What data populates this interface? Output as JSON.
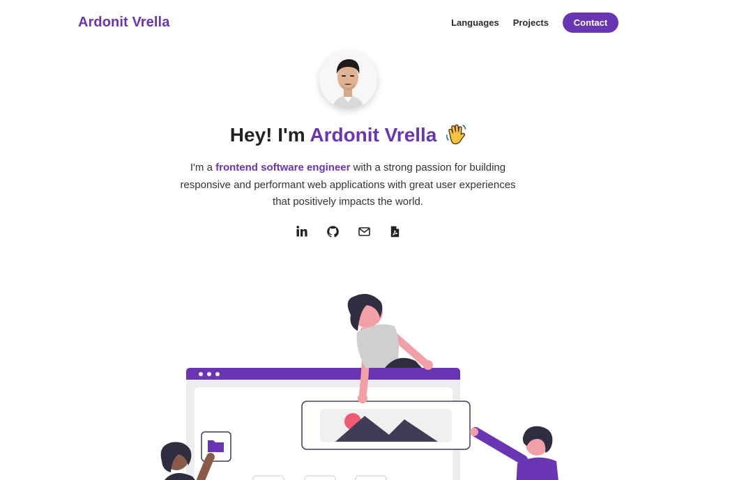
{
  "header": {
    "brand": "Ardonit Vrella",
    "nav": [
      {
        "label": "Languages"
      },
      {
        "label": "Projects"
      }
    ],
    "contact_label": "Contact"
  },
  "hero": {
    "greeting": "Hey! I'm",
    "name": "Ardonit Vrella",
    "wave_icon": "waving-hand-icon",
    "intro_prefix": "I'm a",
    "intro_highlight": "frontend software engineer",
    "intro_suffix": "with a strong passion for building responsive and performant web applications with great user experiences that positively impacts the world."
  },
  "social": [
    {
      "name": "linkedin-icon"
    },
    {
      "name": "github-icon"
    },
    {
      "name": "mail-icon"
    },
    {
      "name": "pdf-resume-icon"
    }
  ],
  "colors": {
    "accent": "#6a35b3",
    "text": "#222222",
    "illustration_pink": "#f2a0a7",
    "illustration_dark": "#3f3d56",
    "illustration_red": "#ee5c73"
  }
}
